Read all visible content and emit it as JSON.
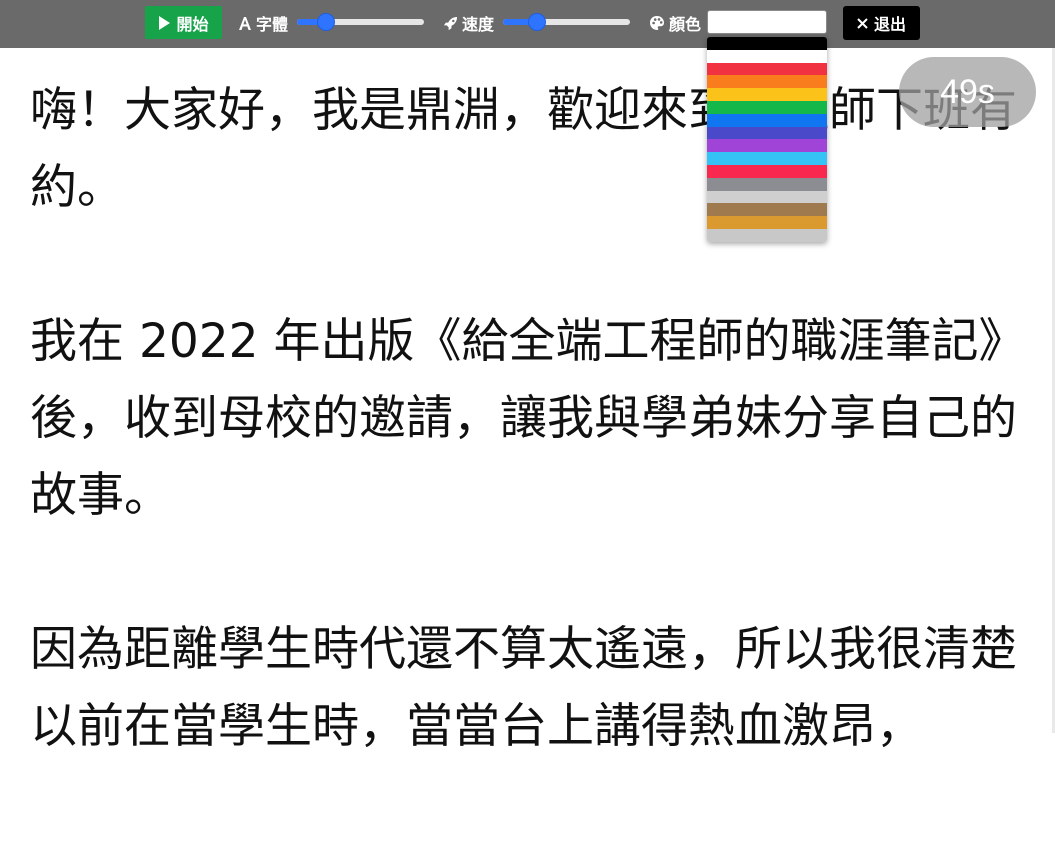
{
  "toolbar": {
    "start_label": "開始",
    "font_size_label": "字體",
    "font_size_slider_fraction": 0.23,
    "speed_label": "速度",
    "speed_slider_fraction": 0.27,
    "color_label": "顏色",
    "color_input_value": "",
    "exit_label": "退出"
  },
  "color_options": [
    "#000000",
    "#ffffff",
    "#f03241",
    "#f97d1c",
    "#fbc21a",
    "#14b84a",
    "#1075f0",
    "#4a49ca",
    "#a044d8",
    "#35c3f5",
    "#f8284f",
    "#8c8c93",
    "#cfcfcf",
    "#a07a4f",
    "#da9a30",
    "#c8c8c8"
  ],
  "timer": "49s",
  "article": {
    "paragraphs": [
      "嗨！大家好，我是鼎淵，歡迎來到工程師下班有約。",
      "我在 2022 年出版《給全端工程師的職涯筆記》後，收到母校的邀請，讓我與學弟妹分享自己的故事。",
      "因為距離學生時代還不算太遙遠，所以我很清楚以前在當學生時，當當台上講得熱血激昂，"
    ]
  },
  "colors": {
    "toolbar_bg": "#6a6a6a",
    "start_button": "#16a34a",
    "exit_button": "#000000",
    "slider_accent": "#2f74ff",
    "text": "#111111"
  }
}
